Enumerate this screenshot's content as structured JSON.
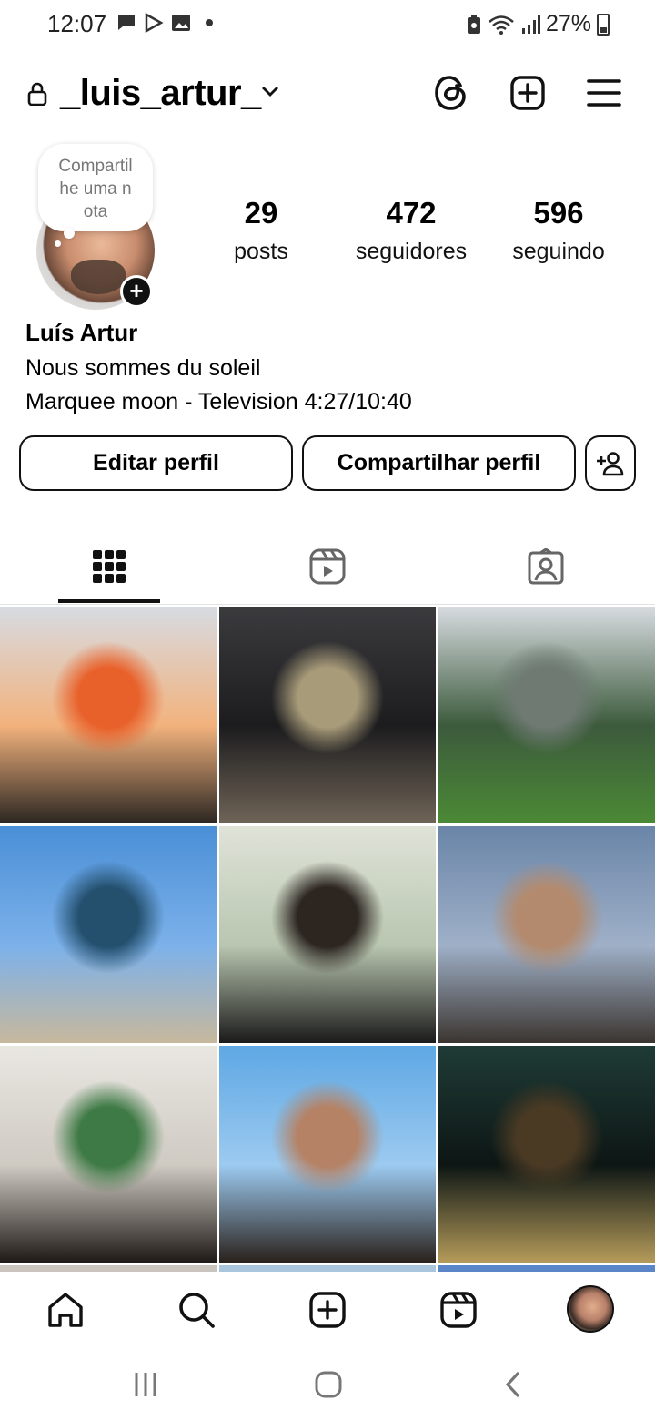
{
  "status_bar": {
    "time": "12:07",
    "battery": "27%"
  },
  "header": {
    "username": "_luis_artur_"
  },
  "profile": {
    "note_placeholder": "Compartilhe uma nota",
    "stats": [
      {
        "value": "29",
        "label": "posts"
      },
      {
        "value": "472",
        "label": "seguidores"
      },
      {
        "value": "596",
        "label": "seguindo"
      }
    ],
    "full_name": "Luís Artur",
    "bio_line1": "Nous sommes du soleil",
    "bio_line2": "Marquee moon - Television 4:27/10:40"
  },
  "actions": {
    "edit_profile": "Editar perfil",
    "share_profile": "Compartilhar perfil"
  },
  "tabs": [
    {
      "icon": "grid-icon",
      "selected": true
    },
    {
      "icon": "reels-icon",
      "selected": false
    },
    {
      "icon": "tagged-icon",
      "selected": false
    }
  ],
  "posts": [
    {
      "subject": "tree silhouette at sunset",
      "colors": [
        "#d7dbe2",
        "#f2b27d",
        "#e8602a",
        "#2b2621"
      ]
    },
    {
      "subject": "full moon over buildings at night",
      "colors": [
        "#3b3b3e",
        "#1c1c1e",
        "#a89b79",
        "#6f6457"
      ]
    },
    {
      "subject": "large tree on city street",
      "colors": [
        "#d7dbe0",
        "#3c5a3c",
        "#6e7a72",
        "#4b8a35"
      ]
    },
    {
      "subject": "man in blue shirt with statue",
      "colors": [
        "#4a8fd6",
        "#7cb1ea",
        "#24506e",
        "#c7b89d"
      ]
    },
    {
      "subject": "man in glass palace",
      "colors": [
        "#dfe3d8",
        "#b9c6b0",
        "#2c2520",
        "#1a1a1a"
      ]
    },
    {
      "subject": "man at dusk over rooftops",
      "colors": [
        "#6a85a8",
        "#9fb0c8",
        "#b38a6d",
        "#3b3530"
      ]
    },
    {
      "subject": "man in green shirt with glass",
      "colors": [
        "#e9e7e2",
        "#cfcac2",
        "#3e7a45",
        "#1f1a17"
      ]
    },
    {
      "subject": "man smiling shirtless under blue sky",
      "colors": [
        "#5ea8e4",
        "#9ccaf0",
        "#b58265",
        "#2a211c"
      ]
    },
    {
      "subject": "fireworks at night near building",
      "colors": [
        "#1f3b36",
        "#0d1614",
        "#4a3a24",
        "#b59b5a"
      ]
    }
  ],
  "bottom_nav": [
    "home-icon",
    "search-icon",
    "create-icon",
    "reels-icon",
    "profile-avatar"
  ]
}
